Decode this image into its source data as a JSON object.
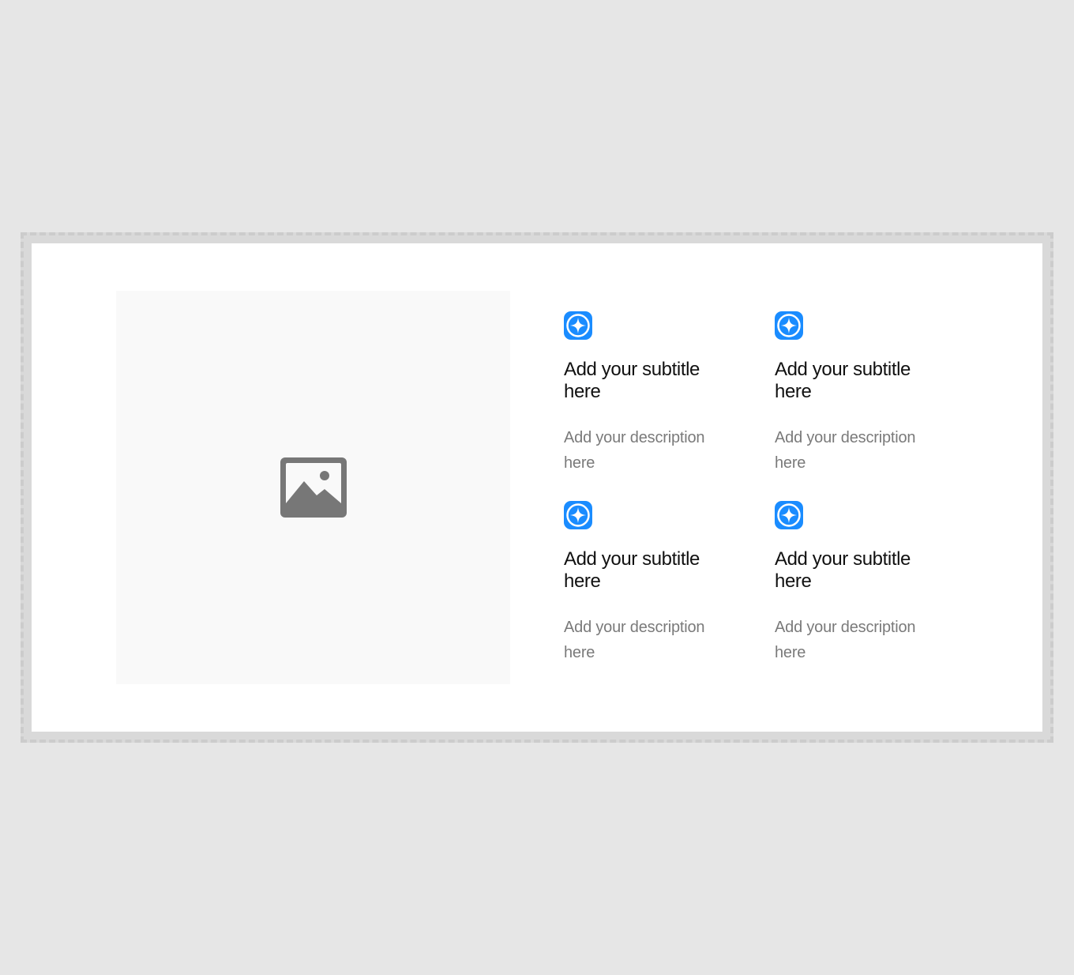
{
  "colors": {
    "page_background": "#e6e6e6",
    "section_background": "#ffffff",
    "dashed_border": "#cccccc",
    "placeholder_background": "#f9f9f9",
    "placeholder_icon": "#777777",
    "feature_icon": "#1a8cff",
    "subtitle_text": "#111111",
    "description_text": "#7a7a7a"
  },
  "media": {
    "icon": "image-placeholder-icon"
  },
  "features": [
    {
      "icon": "sparkle-badge-icon",
      "subtitle": "Add your subtitle here",
      "description": "Add your description here"
    },
    {
      "icon": "sparkle-badge-icon",
      "subtitle": "Add your subtitle here",
      "description": "Add your description here"
    },
    {
      "icon": "sparkle-badge-icon",
      "subtitle": "Add your subtitle here",
      "description": "Add your description here"
    },
    {
      "icon": "sparkle-badge-icon",
      "subtitle": "Add your subtitle here",
      "description": "Add your description here"
    }
  ]
}
